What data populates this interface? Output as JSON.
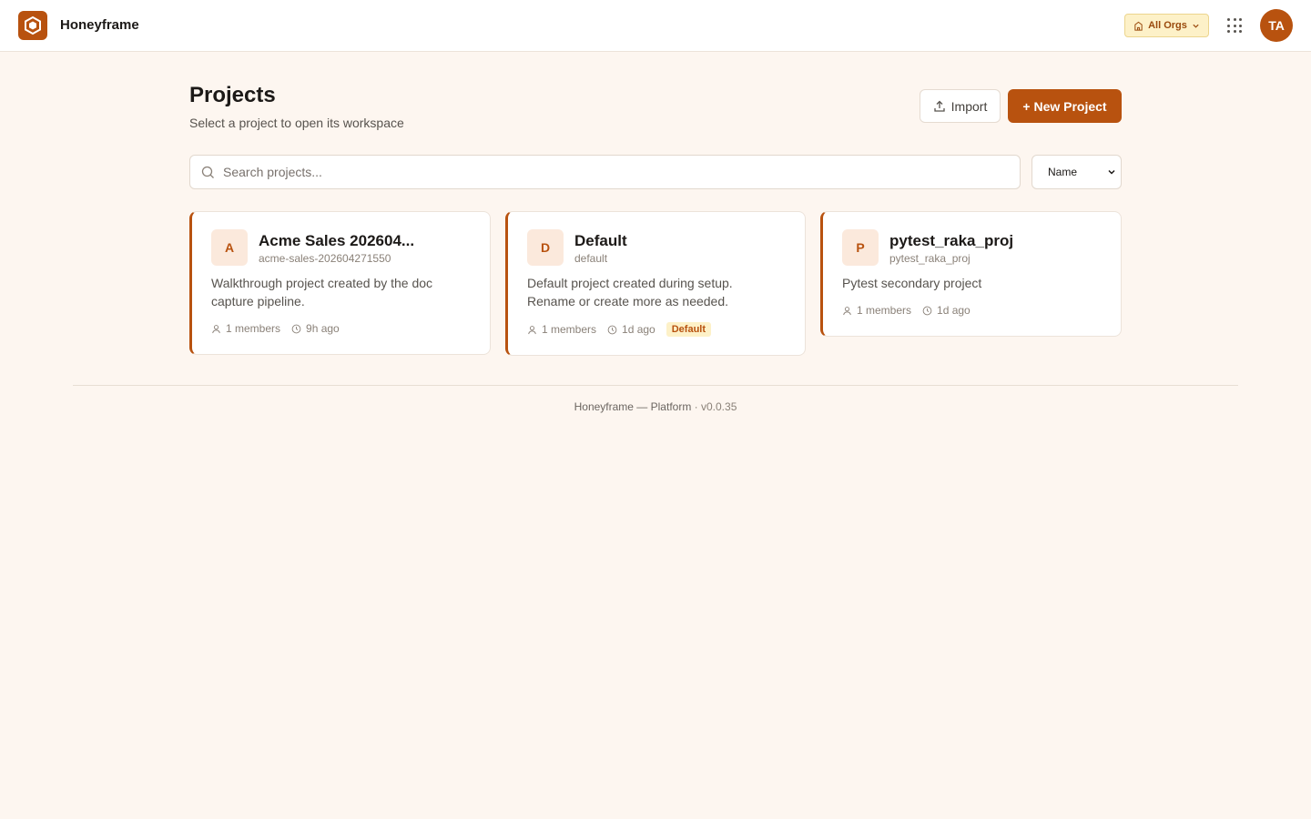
{
  "app": {
    "name": "Honeyframe"
  },
  "header": {
    "org_switcher_label": "All Orgs",
    "avatar_initials": "TA"
  },
  "page": {
    "title": "Projects",
    "subtitle": "Select a project to open its workspace",
    "import_label": "Import",
    "new_project_label": "+ New Project"
  },
  "search": {
    "placeholder": "Search projects...",
    "value": ""
  },
  "sort": {
    "selected": "Name"
  },
  "projects": [
    {
      "initial": "A",
      "name": "Acme Sales 202604...",
      "slug": "acme-sales-202604271550",
      "description": "Walkthrough project created by the doc capture pipeline.",
      "members": "1 members",
      "updated": "9h ago"
    },
    {
      "initial": "D",
      "name": "Default",
      "slug": "default",
      "description": "Default project created during setup. Rename or create more as needed.",
      "members": "1 members",
      "updated": "1d ago",
      "tag": "Default"
    },
    {
      "initial": "P",
      "name": "pytest_raka_proj",
      "slug": "pytest_raka_proj",
      "description": "Pytest secondary project",
      "members": "1 members",
      "updated": "1d ago"
    }
  ],
  "footer": {
    "text": "Honeyframe — Platform",
    "version": "· v0.0.35"
  },
  "colors": {
    "accent": "#b8520f",
    "background": "#fdf6f0",
    "badge_bg": "#fbe9dc",
    "org_bg": "#fdf1c8"
  }
}
